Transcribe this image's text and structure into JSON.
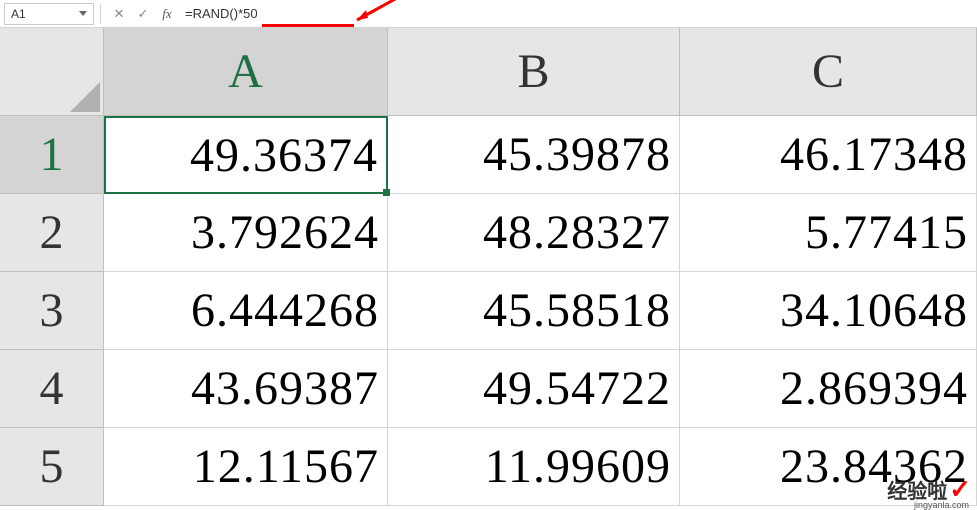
{
  "formula_bar": {
    "name_box": "A1",
    "formula": "=RAND()*50"
  },
  "columns": [
    "A",
    "B",
    "C"
  ],
  "rows": [
    "1",
    "2",
    "3",
    "4",
    "5"
  ],
  "selected_cell": {
    "row": 0,
    "col": 0
  },
  "cells": [
    [
      "49.36374",
      "45.39878",
      "46.17348"
    ],
    [
      "3.792624",
      "48.28327",
      "5.77415"
    ],
    [
      "6.444268",
      "45.58518",
      "34.10648"
    ],
    [
      "43.69387",
      "49.54722",
      "2.869394"
    ],
    [
      "12.11567",
      "11.99609",
      "23.84362"
    ]
  ],
  "watermark": {
    "main": "经验啦",
    "sub": "jingyanla.com"
  }
}
